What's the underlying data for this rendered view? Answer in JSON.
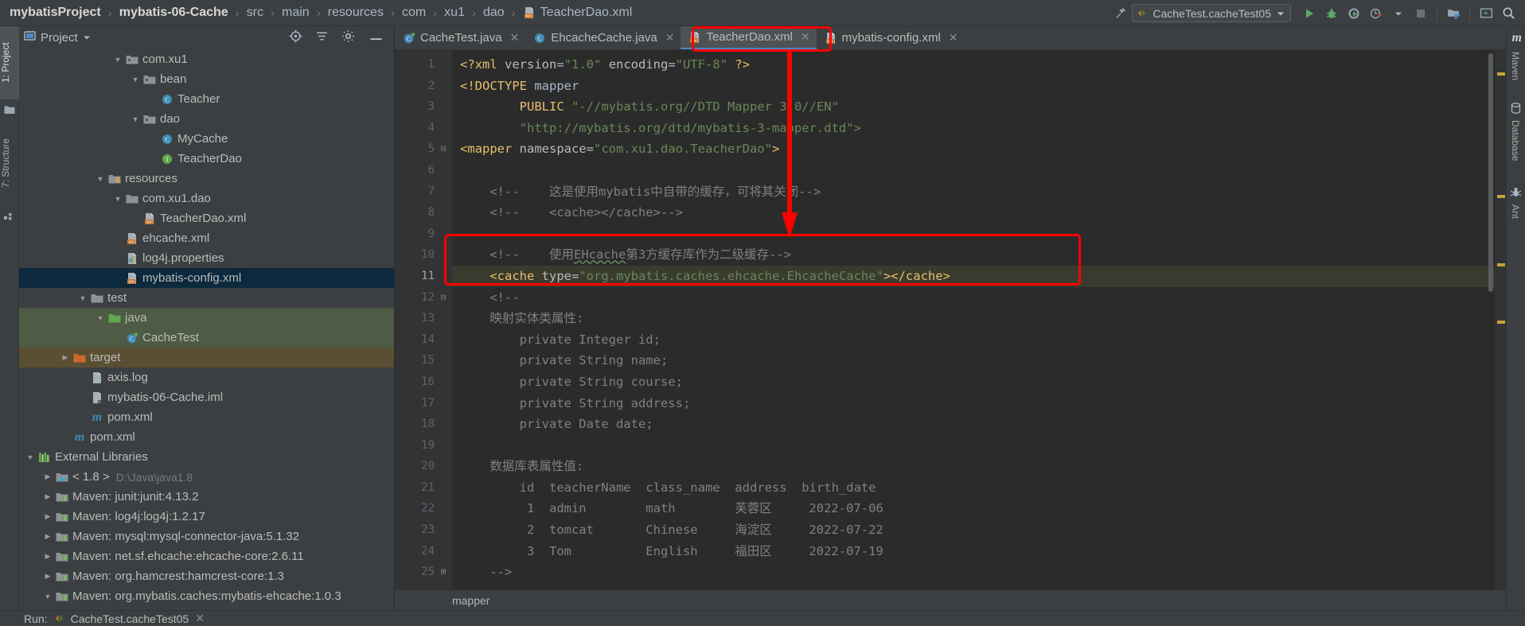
{
  "breadcrumb": {
    "items": [
      {
        "label": "mybatisProject",
        "bold": true
      },
      {
        "label": "mybatis-06-Cache",
        "bold": true
      },
      {
        "label": "src",
        "bold": false
      },
      {
        "label": "main",
        "bold": false
      },
      {
        "label": "resources",
        "bold": false
      },
      {
        "label": "com",
        "bold": false
      },
      {
        "label": "xu1",
        "bold": false
      },
      {
        "label": "dao",
        "bold": false
      }
    ],
    "file": "TeacherDao.xml",
    "separator": "›"
  },
  "toolbar": {
    "run_config": "CacheTest.cacheTest05",
    "run_icon": "run-icon",
    "debug_icon": "debug-icon",
    "coverage_icon": "run-with-coverage-icon",
    "profile_icon": "profile-icon",
    "dropdown_icon": "chevron-down-icon",
    "stop_icon": "stop-icon",
    "hammer_icon": "build-icon",
    "project_structure_icon": "project-structure-icon",
    "terminal_icon": "terminal-icon",
    "search_icon": "search-icon"
  },
  "left_tabs": [
    {
      "label": "1: Project",
      "active": true
    },
    {
      "label": "7: Structure",
      "active": false
    }
  ],
  "right_tabs": [
    {
      "label": "Maven",
      "icon": "maven-icon"
    },
    {
      "label": "Database",
      "icon": "database-icon"
    },
    {
      "label": "Ant",
      "icon": "ant-icon"
    }
  ],
  "project_panel": {
    "title": "Project",
    "dropdown_icon": "chevron-down-icon",
    "locate_icon": "locate-icon",
    "collapse_icon": "collapse-all-icon",
    "settings_icon": "gear-icon",
    "hide_icon": "hide-icon",
    "tree": [
      {
        "label": "com.xu1",
        "indent": 5,
        "arrow": "down",
        "icon": "package-icon",
        "state": "none"
      },
      {
        "label": "bean",
        "indent": 6,
        "arrow": "down",
        "icon": "package-icon",
        "state": "none"
      },
      {
        "label": "Teacher",
        "indent": 7,
        "arrow": "none",
        "icon": "class-icon",
        "state": "none"
      },
      {
        "label": "dao",
        "indent": 6,
        "arrow": "down",
        "icon": "package-icon",
        "state": "none"
      },
      {
        "label": "MyCache",
        "indent": 7,
        "arrow": "none",
        "icon": "class-icon",
        "state": "none"
      },
      {
        "label": "TeacherDao",
        "indent": 7,
        "arrow": "none",
        "icon": "interface-icon",
        "state": "none"
      },
      {
        "label": "resources",
        "indent": 4,
        "arrow": "down",
        "icon": "resources-folder-icon",
        "state": "none"
      },
      {
        "label": "com.xu1.dao",
        "indent": 5,
        "arrow": "down",
        "icon": "folder-icon",
        "state": "none"
      },
      {
        "label": "TeacherDao.xml",
        "indent": 6,
        "arrow": "none",
        "icon": "xml-file-icon",
        "state": "none"
      },
      {
        "label": "ehcache.xml",
        "indent": 5,
        "arrow": "none",
        "icon": "xml-file-icon",
        "state": "none"
      },
      {
        "label": "log4j.properties",
        "indent": 5,
        "arrow": "none",
        "icon": "properties-file-icon",
        "state": "none"
      },
      {
        "label": "mybatis-config.xml",
        "indent": 5,
        "arrow": "none",
        "icon": "xml-file-icon",
        "state": "selected"
      },
      {
        "label": "test",
        "indent": 3,
        "arrow": "down",
        "icon": "folder-icon",
        "state": "none"
      },
      {
        "label": "java",
        "indent": 4,
        "arrow": "down",
        "icon": "test-source-folder-icon",
        "state": "green"
      },
      {
        "label": "CacheTest",
        "indent": 5,
        "arrow": "none",
        "icon": "test-class-icon",
        "state": "green"
      },
      {
        "label": "target",
        "indent": 2,
        "arrow": "right",
        "icon": "excluded-folder-icon",
        "state": "brown"
      },
      {
        "label": "axis.log",
        "indent": 3,
        "arrow": "none",
        "icon": "unknown-file-icon",
        "state": "none"
      },
      {
        "label": "mybatis-06-Cache.iml",
        "indent": 3,
        "arrow": "none",
        "icon": "iml-file-icon",
        "state": "none"
      },
      {
        "label": "pom.xml",
        "indent": 3,
        "arrow": "none",
        "icon": "maven-file-icon",
        "state": "none"
      },
      {
        "label": "pom.xml",
        "indent": 2,
        "arrow": "none",
        "icon": "maven-file-icon",
        "state": "none"
      },
      {
        "label": "External Libraries",
        "indent": 0,
        "arrow": "down",
        "icon": "libraries-icon",
        "state": "none"
      },
      {
        "label": "< 1.8 >",
        "indent": 1,
        "arrow": "right",
        "icon": "jdk-icon",
        "state": "none",
        "sublabel": "D:\\Java\\java1.8"
      },
      {
        "label": "Maven: junit:junit:4.13.2",
        "indent": 1,
        "arrow": "right",
        "icon": "library-icon",
        "state": "none"
      },
      {
        "label": "Maven: log4j:log4j:1.2.17",
        "indent": 1,
        "arrow": "right",
        "icon": "library-icon",
        "state": "none"
      },
      {
        "label": "Maven: mysql:mysql-connector-java:5.1.32",
        "indent": 1,
        "arrow": "right",
        "icon": "library-icon",
        "state": "none"
      },
      {
        "label": "Maven: net.sf.ehcache:ehcache-core:2.6.11",
        "indent": 1,
        "arrow": "right",
        "icon": "library-icon",
        "state": "none"
      },
      {
        "label": "Maven: org.hamcrest:hamcrest-core:1.3",
        "indent": 1,
        "arrow": "right",
        "icon": "library-icon",
        "state": "none"
      },
      {
        "label": "Maven: org.mybatis.caches:mybatis-ehcache:1.0.3",
        "indent": 1,
        "arrow": "down",
        "icon": "library-icon",
        "state": "none"
      }
    ]
  },
  "editor": {
    "tabs": [
      {
        "label": "CacheTest.java",
        "icon": "test-class-icon",
        "active": false
      },
      {
        "label": "EhcacheCache.java",
        "icon": "class-icon",
        "active": false
      },
      {
        "label": "TeacherDao.xml",
        "icon": "xml-file-icon",
        "active": true
      },
      {
        "label": "mybatis-config.xml",
        "icon": "xml-file-icon",
        "active": false
      }
    ],
    "close_icon": "close-icon",
    "status_breadcrumb": "mapper",
    "lines": [
      {
        "n": 1,
        "hl": false,
        "fold": "",
        "parts": [
          {
            "t": "<?xml ",
            "c": "tag"
          },
          {
            "t": "version",
            "c": "attr"
          },
          {
            "t": "=",
            "c": "plain"
          },
          {
            "t": "\"1.0\"",
            "c": "str"
          },
          {
            "t": " ",
            "c": "plain"
          },
          {
            "t": "encoding",
            "c": "attr"
          },
          {
            "t": "=",
            "c": "plain"
          },
          {
            "t": "\"UTF-8\"",
            "c": "str"
          },
          {
            "t": " ",
            "c": "plain"
          },
          {
            "t": "?>",
            "c": "tag"
          }
        ]
      },
      {
        "n": 2,
        "hl": false,
        "fold": "",
        "parts": [
          {
            "t": "<!DOCTYPE ",
            "c": "tag"
          },
          {
            "t": "mapper",
            "c": "plain"
          }
        ]
      },
      {
        "n": 3,
        "hl": false,
        "fold": "",
        "parts": [
          {
            "t": "        ",
            "c": "plain"
          },
          {
            "t": "PUBLIC",
            "c": "tag"
          },
          {
            "t": " ",
            "c": "plain"
          },
          {
            "t": "\"-//mybatis.org//DTD Mapper 3.0//EN\"",
            "c": "str"
          }
        ]
      },
      {
        "n": 4,
        "hl": false,
        "fold": "",
        "parts": [
          {
            "t": "        ",
            "c": "plain"
          },
          {
            "t": "\"http://mybatis.org/dtd/mybatis-3-mapper.dtd\">",
            "c": "str"
          }
        ]
      },
      {
        "n": 5,
        "hl": false,
        "fold": "minus",
        "parts": [
          {
            "t": "<mapper ",
            "c": "tag"
          },
          {
            "t": "namespace",
            "c": "attr"
          },
          {
            "t": "=",
            "c": "plain"
          },
          {
            "t": "\"com.xu1.dao.TeacherDao\"",
            "c": "str"
          },
          {
            "t": ">",
            "c": "tag"
          }
        ]
      },
      {
        "n": 6,
        "hl": false,
        "fold": "",
        "parts": []
      },
      {
        "n": 7,
        "hl": false,
        "fold": "",
        "parts": [
          {
            "t": "    <!--    这是使用mybatis中自带的缓存，可将其关闭-->",
            "c": "cmt"
          }
        ]
      },
      {
        "n": 8,
        "hl": false,
        "fold": "",
        "parts": [
          {
            "t": "    <!--    <cache></cache>-->",
            "c": "cmt"
          }
        ]
      },
      {
        "n": 9,
        "hl": false,
        "fold": "",
        "parts": []
      },
      {
        "n": 10,
        "hl": false,
        "fold": "",
        "parts": [
          {
            "t": "    <!--    使用",
            "c": "cmt"
          },
          {
            "t": "EHcache",
            "c": "cmtwavy"
          },
          {
            "t": "第3方缓存库作为二级缓存-->",
            "c": "cmt"
          }
        ]
      },
      {
        "n": 11,
        "hl": true,
        "fold": "",
        "parts": [
          {
            "t": "    ",
            "c": "plain"
          },
          {
            "t": "<cache ",
            "c": "tag"
          },
          {
            "t": "type",
            "c": "attr"
          },
          {
            "t": "=",
            "c": "plain"
          },
          {
            "t": "\"org.mybatis.caches.ehcache.EhcacheCache\"",
            "c": "str"
          },
          {
            "t": "></cache>",
            "c": "tag"
          }
        ]
      },
      {
        "n": 12,
        "hl": false,
        "fold": "minus",
        "parts": [
          {
            "t": "    <!--",
            "c": "cmt"
          }
        ]
      },
      {
        "n": 13,
        "hl": false,
        "fold": "",
        "parts": [
          {
            "t": "    映射实体类属性:",
            "c": "cmt"
          }
        ]
      },
      {
        "n": 14,
        "hl": false,
        "fold": "",
        "parts": [
          {
            "t": "        private Integer id;",
            "c": "cmt"
          }
        ]
      },
      {
        "n": 15,
        "hl": false,
        "fold": "",
        "parts": [
          {
            "t": "        private String name;",
            "c": "cmt"
          }
        ]
      },
      {
        "n": 16,
        "hl": false,
        "fold": "",
        "parts": [
          {
            "t": "        private String course;",
            "c": "cmt"
          }
        ]
      },
      {
        "n": 17,
        "hl": false,
        "fold": "",
        "parts": [
          {
            "t": "        private String address;",
            "c": "cmt"
          }
        ]
      },
      {
        "n": 18,
        "hl": false,
        "fold": "",
        "parts": [
          {
            "t": "        private Date date;",
            "c": "cmt"
          }
        ]
      },
      {
        "n": 19,
        "hl": false,
        "fold": "",
        "parts": []
      },
      {
        "n": 20,
        "hl": false,
        "fold": "",
        "parts": [
          {
            "t": "    数据库表属性值:",
            "c": "cmt"
          }
        ]
      },
      {
        "n": 21,
        "hl": false,
        "fold": "",
        "parts": [
          {
            "t": "        id  teacherName  class_name  address  birth_date",
            "c": "cmt"
          }
        ]
      },
      {
        "n": 22,
        "hl": false,
        "fold": "",
        "parts": [
          {
            "t": "         1  admin        math        芙蓉区     2022-07-06",
            "c": "cmt"
          }
        ]
      },
      {
        "n": 23,
        "hl": false,
        "fold": "",
        "parts": [
          {
            "t": "         2  tomcat       Chinese     海淀区     2022-07-22",
            "c": "cmt"
          }
        ]
      },
      {
        "n": 24,
        "hl": false,
        "fold": "",
        "parts": [
          {
            "t": "         3  Tom          English     福田区     2022-07-19",
            "c": "cmt"
          }
        ]
      },
      {
        "n": 25,
        "hl": false,
        "fold": "plus",
        "parts": [
          {
            "t": "    -->",
            "c": "cmt"
          }
        ]
      }
    ]
  },
  "run_bar": {
    "label": "Run:",
    "config": "CacheTest.cacheTest05",
    "icon": "run-config-icon",
    "close_icon": "close-icon"
  },
  "annotations": {
    "tab_highlight": "TeacherDao.xml",
    "cache_highlight": "<cache type=\"org.mybatis.caches.ehcache.EhcacheCache\"></cache>",
    "arrow_color": "#ff0000"
  },
  "colors": {
    "accent": "#4a88c7",
    "selection": "#0d293e",
    "annotation": "#ff0000",
    "editor_bg": "#2b2b2b",
    "panel_bg": "#3c3f41",
    "string": "#6a8759",
    "tag": "#e8bf6a",
    "comment": "#808080"
  }
}
